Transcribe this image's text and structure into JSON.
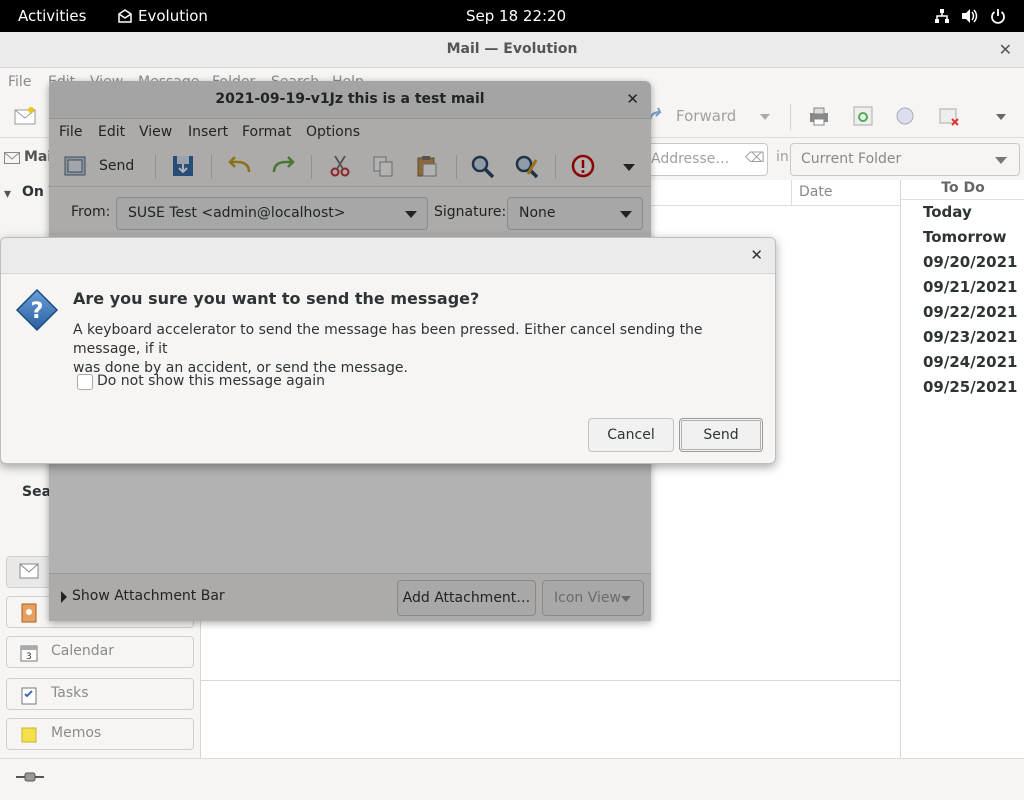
{
  "topbar": {
    "activities": "Activities",
    "app_name": "Evolution",
    "clock": "Sep 18  22:20"
  },
  "main_window": {
    "title": "Mail — Evolution",
    "menu": [
      "File",
      "Edit",
      "View",
      "Message",
      "Folder",
      "Search",
      "Help"
    ],
    "toolbar_forward": "Forward",
    "search_placeholder": "Addresse…",
    "search_in": "in",
    "scope": "Current Folder",
    "column_date": "Date",
    "sidebar_partial": [
      "Mai",
      "On T",
      "Sear"
    ],
    "switcher": [
      "Calendar",
      "Tasks",
      "Memos"
    ]
  },
  "todo": {
    "header": "To Do",
    "items": [
      "Today",
      "Tomorrow",
      "09/20/2021",
      "09/21/2021",
      "09/22/2021",
      "09/23/2021",
      "09/24/2021",
      "09/25/2021"
    ]
  },
  "composer": {
    "title": "2021-09-19-v1Jz this is a test mail",
    "menu": [
      "File",
      "Edit",
      "View",
      "Insert",
      "Format",
      "Options"
    ],
    "send_label": "Send",
    "from_label": "From:",
    "from_value": "SUSE Test <admin@localhost>",
    "signature_label": "Signature:",
    "signature_value": "None",
    "show_attachment_bar": "Show Attachment Bar",
    "add_attachment": "Add Attachment…",
    "icon_view": "Icon View"
  },
  "dialog": {
    "title": "Are you sure you want to send the message?",
    "text_line1": "A keyboard accelerator to send the message has been pressed. Either cancel sending the message, if it",
    "text_line2": "was done by an accident, or send the message.",
    "checkbox_label": "Do not show this message again",
    "cancel": "Cancel",
    "send": "Send"
  }
}
